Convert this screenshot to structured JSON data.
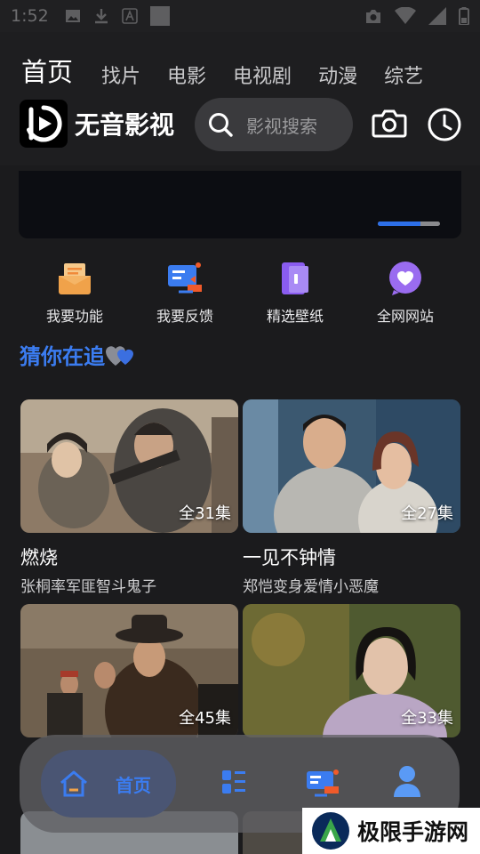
{
  "status_bar": {
    "time": "1:52"
  },
  "header": {
    "tabs": [
      {
        "label": "首页"
      },
      {
        "label": "找片"
      },
      {
        "label": "电影"
      },
      {
        "label": "电视剧"
      },
      {
        "label": "动漫"
      },
      {
        "label": "综艺"
      }
    ],
    "brand_name": "无音影视",
    "search_placeholder": "影视搜索",
    "icons": [
      "camera-icon",
      "history-clock-icon"
    ]
  },
  "banner": {
    "indicator_progress": 0.68,
    "accent": "#2d6fe8"
  },
  "shortcuts": [
    {
      "label": "我要功能",
      "icon": "request-feature-icon",
      "color": "#f0a24a"
    },
    {
      "label": "我要反馈",
      "icon": "feedback-icon",
      "color": "#3b7cf0"
    },
    {
      "label": "精选壁纸",
      "icon": "wallpaper-icon",
      "color": "#8a5cf0"
    },
    {
      "label": "全网网站",
      "icon": "heart-site-icon",
      "color": "#9a6cf0"
    }
  ],
  "section": {
    "title": "猜你在追"
  },
  "videos": [
    {
      "title": "燃烧",
      "subtitle": "张桐率军匪智斗鬼子",
      "episodes": "全31集"
    },
    {
      "title": "一见不钟情",
      "subtitle": "郑恺变身爱情小恶魔",
      "episodes": "全27集"
    },
    {
      "title": "",
      "subtitle": "",
      "episodes": "全45集"
    },
    {
      "title": "",
      "subtitle": "",
      "episodes": "全33集"
    }
  ],
  "bottom_nav": {
    "home_label": "首页",
    "items": [
      "home-icon",
      "list-icon",
      "feed-icon",
      "user-icon"
    ],
    "active_color": "#3b7cf0"
  },
  "watermark": {
    "text": "极限手游网"
  }
}
